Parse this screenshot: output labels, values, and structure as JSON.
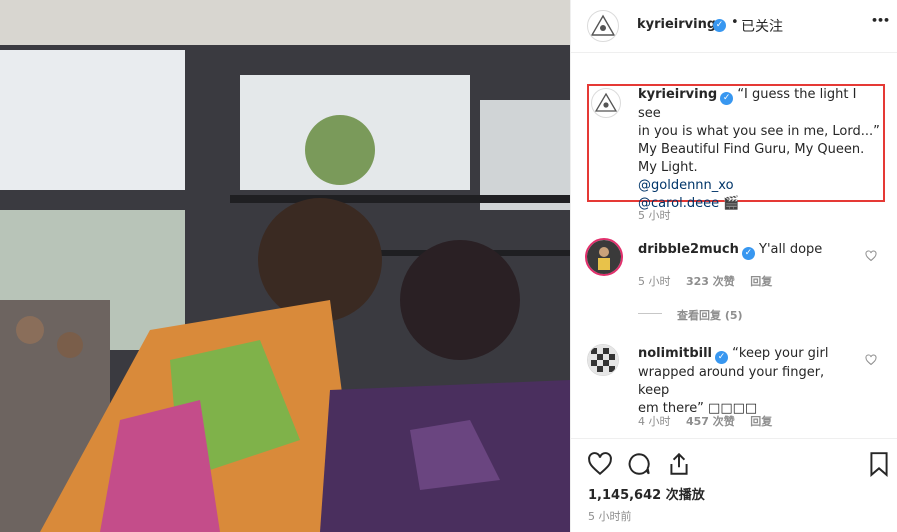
{
  "header": {
    "username": "kyrieirving",
    "separator": "•",
    "follow_label": "已关注",
    "more": "•••"
  },
  "caption": {
    "username": "kyrieirving",
    "lines": [
      "“I guess the light I see",
      "in you is what you see in me, Lord...”",
      "My Beautiful Find Guru, My Queen.",
      "My Light."
    ],
    "mentions": [
      "@goldennn_xo",
      "@carol.deee"
    ],
    "mention_suffix": "🎬",
    "time": "5 小时"
  },
  "comments": [
    {
      "username": "dribble2much",
      "text_lines": [
        "Y'all dope"
      ],
      "time": "5 小时",
      "likes": "323 次赞",
      "reply": "回复"
    },
    {
      "username": "nolimitbill",
      "text_lines": [
        "“keep your girl",
        "wrapped around your finger, keep",
        "em there” □□□□"
      ],
      "time": "4 小时",
      "likes": "457 次赞",
      "reply": "回复"
    }
  ],
  "view_replies": "查看回复 (5)",
  "footer": {
    "views_count": "1,145,642",
    "views_label": "次播放",
    "timestamp": "5 小时前"
  },
  "colors": {
    "verified": "#3897f0",
    "highlight": "#e53935"
  }
}
